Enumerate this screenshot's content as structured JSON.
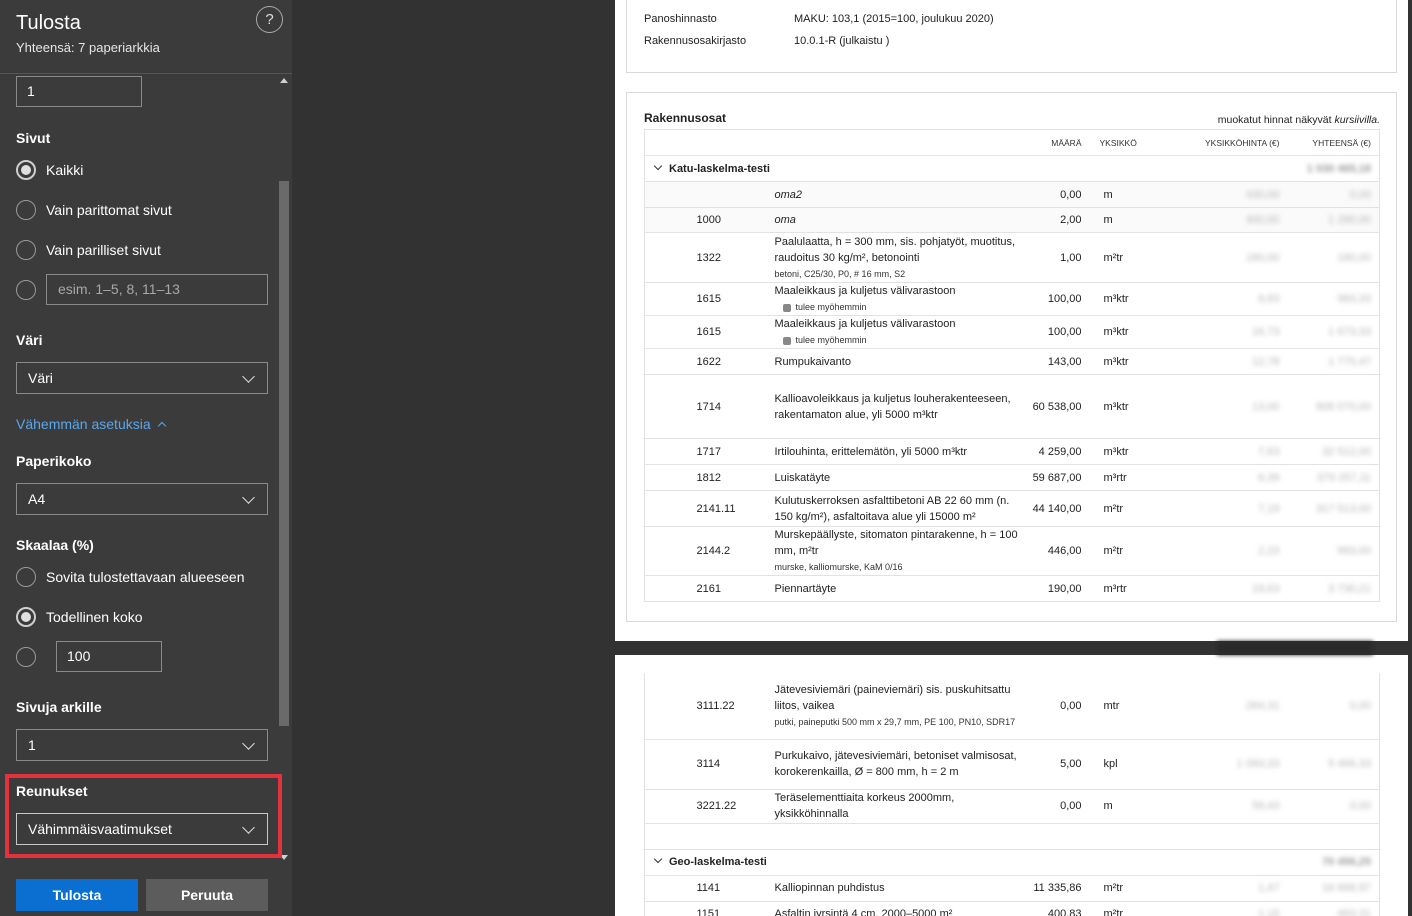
{
  "panel": {
    "title": "Tulosta",
    "subtitle": "Yhteensä: 7 paperiarkkia",
    "help": "?",
    "copies_value": "1",
    "pages": {
      "label": "Sivut",
      "options": [
        "Kaikki",
        "Vain parittomat sivut",
        "Vain parilliset sivut"
      ],
      "custom_placeholder": "esim. 1–5, 8, 11–13"
    },
    "color": {
      "label": "Väri",
      "value": "Väri"
    },
    "less_settings": "Vähemmän asetuksia",
    "paper": {
      "label": "Paperikoko",
      "value": "A4"
    },
    "scale": {
      "label": "Skaalaa (%)",
      "options": [
        "Sovita tulostettavaan alueeseen",
        "Todellinen koko"
      ],
      "custom_value": "100"
    },
    "pages_per_sheet": {
      "label": "Sivuja arkille",
      "value": "1"
    },
    "margins": {
      "label": "Reunukset",
      "value": "Vähimmäisvaatimukset"
    },
    "print_button": "Tulosta",
    "cancel_button": "Peruuta"
  },
  "preview": {
    "meta": [
      {
        "key": "Panoshinnasto",
        "value": "MAKU: 103,1 (2015=100, joulukuu 2020)"
      },
      {
        "key": "Rakennusosakirjasto",
        "value": "10.0.1-R (julkaistu )"
      }
    ],
    "section_title": "Rakennusosat",
    "note_prefix": "muokatut hinnat näkyvät ",
    "note_italic": "kursiivilla.",
    "columns": [
      "MÄÄRÄ",
      "YKSIKKÖ",
      "YKSIKKÖHINTA (€)",
      "YHTEENSÄ (€)"
    ],
    "group1": {
      "name": "Katu-laskelma-testi",
      "total": "1 030 465,18"
    },
    "rows1": [
      {
        "code": "",
        "name": "oma2",
        "italic": true,
        "qty": "0,00",
        "unit": "m",
        "price": "430,00",
        "total": "0,00"
      },
      {
        "code": "1000",
        "name": "oma",
        "italic": true,
        "qty": "2,00",
        "unit": "m",
        "price": "400,00",
        "total": "1 290,00"
      },
      {
        "code": "1322",
        "name": "Paalulaatta, h = 300 mm, sis. pohjatyöt, muotitus, raudoitus 30 kg/m², betonointi",
        "note": "betoni, C25/30, P0, # 16 mm, S2",
        "qty": "1,00",
        "unit": "m²tr",
        "price": "180,00",
        "total": "180,00"
      },
      {
        "code": "1615",
        "name": "Maaleikkaus ja kuljetus välivarastoon",
        "badge": "tulee myöhemmin",
        "qty": "100,00",
        "unit": "m³ktr",
        "price": "9,83",
        "total": "983,33"
      },
      {
        "code": "1615",
        "name": "Maaleikkaus ja kuljetus välivarastoon",
        "badge": "tulee myöhemmin",
        "qty": "100,00",
        "unit": "m³ktr",
        "price": "16,73",
        "total": "1 673,33"
      },
      {
        "code": "1622",
        "name": "Rumpukaivanto",
        "qty": "143,00",
        "unit": "m³ktr",
        "price": "12,78",
        "total": "1 770,47"
      },
      {
        "code": "1714",
        "name": "Kallioavoleikkaus ja kuljetus louherakenteeseen, rakentamaton alue, yli 5000 m³ktr",
        "qty": "60 538,00",
        "unit": "m³ktr",
        "price": "13,00",
        "total": "908 070,00"
      },
      {
        "code": "1717",
        "name": "Irtilouhinta, erittelemätön, yli 5000 m³ktr",
        "qty": "4 259,00",
        "unit": "m³ktr",
        "price": "7,63",
        "total": "32 512,00"
      },
      {
        "code": "1812",
        "name": "Luiskatäyte",
        "qty": "59 687,00",
        "unit": "m³rtr",
        "price": "6,39",
        "total": "379 257,11"
      },
      {
        "code": "2141.11",
        "name": "Kulutuskerroksen asfalttibetoni AB 22 60 mm (n. 150 kg/m²), asfaltoitava alue yli 15000 m²",
        "qty": "44 140,00",
        "unit": "m²tr",
        "price": "7,19",
        "total": "317 513,00"
      },
      {
        "code": "2144.2",
        "name": "Murskepäällyste, sitomaton pintarakenne, h = 100 mm, m²tr",
        "note": "murske, kalliomurske, KaM 0/16",
        "qty": "446,00",
        "unit": "m²tr",
        "price": "2,23",
        "total": "993,00"
      },
      {
        "code": "2161",
        "name": "Piennartäyte",
        "qty": "190,00",
        "unit": "m³rtr",
        "price": "19,63",
        "total": "3 730,21"
      }
    ],
    "rows2": [
      {
        "code": "3111.22",
        "name": "Jätevesiviemäri (paineviemäri) sis. puskuhitsattu liitos, vaikea",
        "note": "putki, paineputki 500 mm x 29,7 mm, PE 100, PN10, SDR17",
        "qty": "0,00",
        "unit": "mtr",
        "price": "264,31",
        "total": "0,00"
      },
      {
        "code": "3114",
        "name": "Purkukaivo, jätevesiviemäri, betoniset valmisosat, korokerenkailla, Ø = 800 mm, h = 2 m",
        "qty": "5,00",
        "unit": "kpl",
        "price": "1 093,33",
        "total": "5 466,33"
      },
      {
        "code": "3221.22",
        "name": "Teräselementtiaita korkeus 2000mm, yksikköhinnalla",
        "qty": "0,00",
        "unit": "m",
        "price": "59,43",
        "total": "0,00"
      }
    ],
    "group2": {
      "name": "Geo-laskelma-testi",
      "total": "70 456,25"
    },
    "rows3": [
      {
        "code": "1141",
        "name": "Kalliopinnan puhdistus",
        "qty": "11 335,86",
        "unit": "m²tr",
        "price": "1,47",
        "total": "16 668,97"
      },
      {
        "code": "1151",
        "name": "Asfaltin jyrsintä 4 cm, 2000–5000 m²",
        "qty": "400,83",
        "unit": "m²tr",
        "price": "1,16",
        "total": "463,31"
      }
    ]
  }
}
